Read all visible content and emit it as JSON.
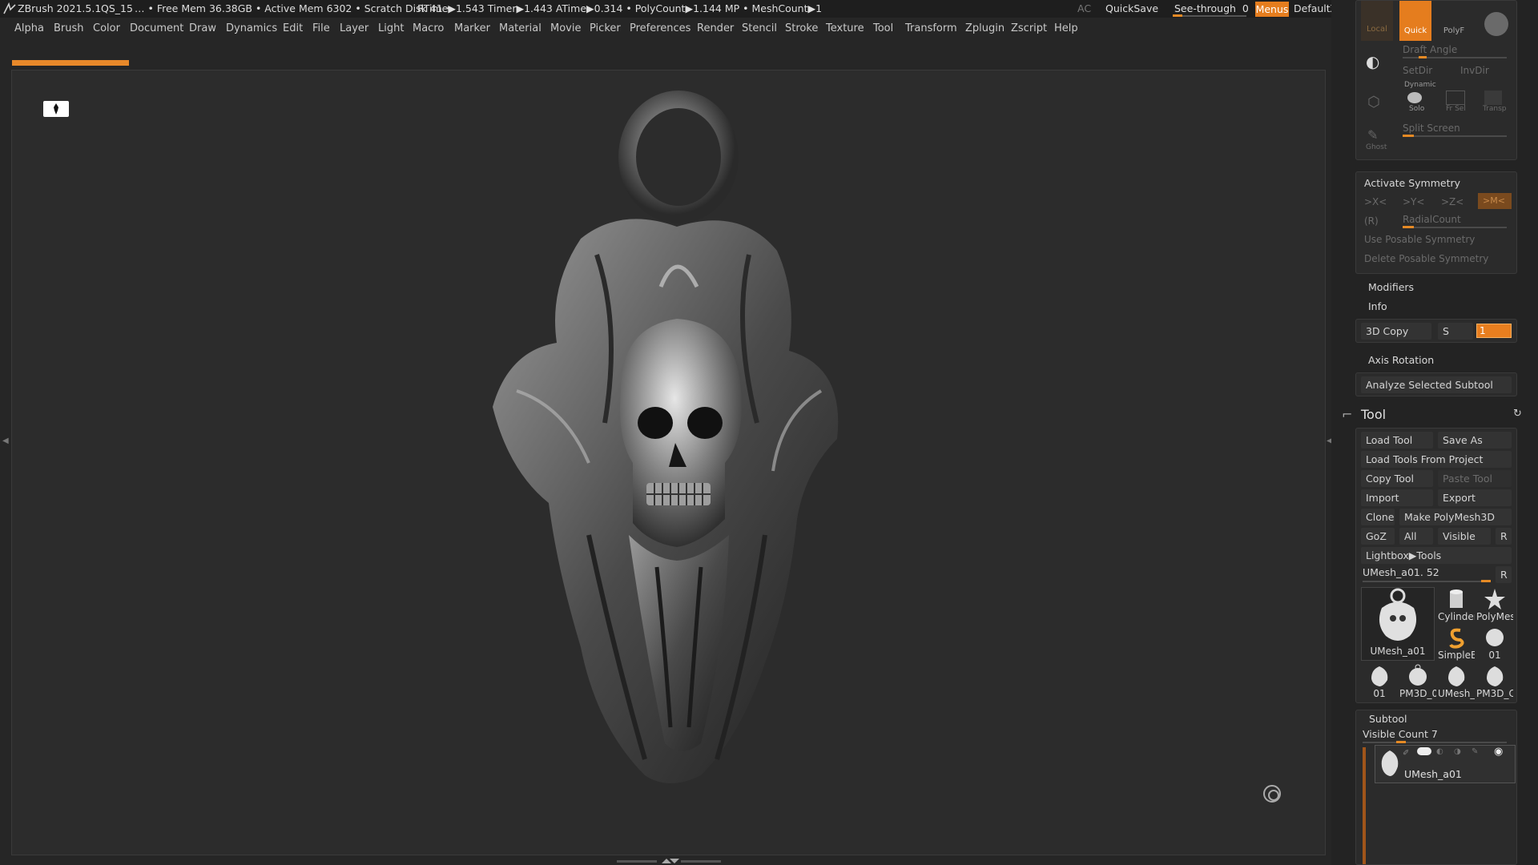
{
  "titlebar": {
    "app": "ZBrush 2021.5.1",
    "project": "QS_15",
    "stats": "… • Free Mem 36.38GB • Active Mem 6302 • Scratch Disk 41 •",
    "timing": "RTime▶1.543 Timer▶1.443 ATime▶0.314 • PolyCount▶1.144 MP • MeshCount▶1",
    "ac": "AC",
    "quicksave": "QuickSave",
    "see_through_label": "See-through",
    "see_through_value": "0",
    "menus": "Menus",
    "script": "DefaultZScript"
  },
  "menubar": [
    "Alpha",
    "Brush",
    "Color",
    "Document",
    "Draw",
    "Dynamics",
    "Edit",
    "File",
    "Layer",
    "Light",
    "Macro",
    "Marker",
    "Material",
    "Movie",
    "Picker",
    "Preferences",
    "Render",
    "Stencil",
    "Stroke",
    "Texture",
    "Tool",
    "Transform",
    "Zplugin",
    "Zscript",
    "Help"
  ],
  "top_panel": {
    "local": "Local",
    "quick": "Quick",
    "polyf": "PolyF",
    "draft_angle": "Draft Angle",
    "setdir": "SetDir",
    "invdir": "InvDir",
    "dynamic": "Dynamic",
    "solo": "Solo",
    "frsel": "Fr Sel",
    "transp": "Transp",
    "split_screen": "Split Screen",
    "ghost": "Ghost"
  },
  "symmetry": {
    "activate": "Activate Symmetry",
    "x": ">X<",
    "y": ">Y<",
    "z": ">Z<",
    "m": ">M<",
    "r": "(R)",
    "radial": "RadialCount",
    "use_posable": "Use Posable Symmetry",
    "delete_posable": "Delete Posable Symmetry"
  },
  "sections": {
    "modifiers": "Modifiers",
    "info": "Info",
    "copy3d": "3D Copy",
    "s": "S",
    "copy_value": "1",
    "axis_rotation": "Axis Rotation",
    "analyze": "Analyze Selected Subtool"
  },
  "tool": {
    "title": "Tool",
    "load_tool": "Load Tool",
    "save_as": "Save As",
    "load_from_project": "Load Tools From Project",
    "copy_tool": "Copy Tool",
    "paste_tool": "Paste Tool",
    "import": "Import",
    "export": "Export",
    "clone": "Clone",
    "make_polymesh": "Make PolyMesh3D",
    "goz": "GoZ",
    "all": "All",
    "visible": "Visible",
    "r": "R",
    "lightbox": "Lightbox▶Tools",
    "current": "UMesh_a01. 52",
    "thumbs": [
      {
        "name": "UMesh_a01"
      },
      {
        "name": "Cylinder"
      },
      {
        "name": "PolyMes"
      },
      {
        "name": "SimpleB"
      },
      {
        "name": "01"
      },
      {
        "name": "01"
      },
      {
        "name": "PM3D_0"
      },
      {
        "name": "UMesh_"
      },
      {
        "name": "PM3D_C"
      }
    ]
  },
  "subtool": {
    "title": "Subtool",
    "visible_count": "Visible Count 7",
    "item_name": "UMesh_a01"
  },
  "colors": {
    "accent": "#e8892a",
    "panel": "#2b2b2b",
    "canvas": "#2c2c2c"
  }
}
